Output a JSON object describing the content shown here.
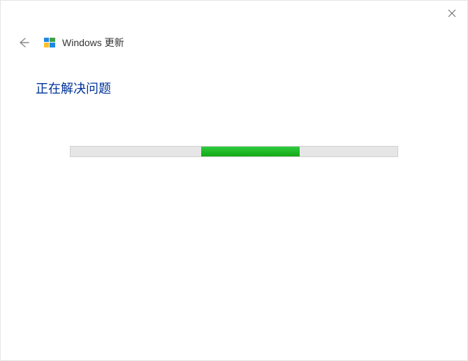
{
  "dialog": {
    "title": "Windows 更新",
    "status_text": "正在解决问题"
  },
  "progress": {
    "start_percent": 40,
    "end_percent": 70,
    "bar_color": "#14a814",
    "track_color": "#e6e6e6"
  }
}
